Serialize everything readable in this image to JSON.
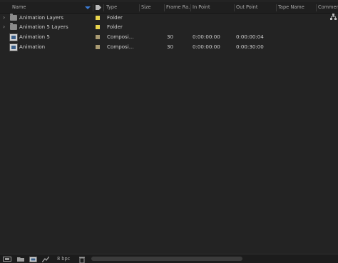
{
  "columns": {
    "name": "Name",
    "type": "Type",
    "size": "Size",
    "frame_rate": "Frame Ra...",
    "in_point": "In Point",
    "out_point": "Out Point",
    "tape_name": "Tape Name",
    "comment": "Commen"
  },
  "rows": [
    {
      "name": "Animation Layers",
      "type": "Folder",
      "frame_rate": "",
      "in_point": "",
      "out_point": "",
      "label_color": "#e8d44d"
    },
    {
      "name": "Animation 5 Layers",
      "type": "Folder",
      "frame_rate": "",
      "in_point": "",
      "out_point": "",
      "label_color": "#e8d44d"
    },
    {
      "name": "Animation 5",
      "type": "Composi...",
      "frame_rate": "30",
      "in_point": "0:00:00:00",
      "out_point": "0:00:00:04",
      "label_color": "#a99a72"
    },
    {
      "name": "Animation",
      "type": "Composi...",
      "frame_rate": "30",
      "in_point": "0:00:00:00",
      "out_point": "0:00:30:00",
      "label_color": "#a99a72"
    }
  ],
  "footer": {
    "bit_depth": "8 bpc"
  },
  "colors": {
    "panel_bg": "#232323",
    "accent": "#3a7bd5"
  },
  "icons": [
    "chevron-right-icon",
    "folder-icon",
    "composition-icon",
    "label-icon",
    "flowchart-icon",
    "interpret-footage-icon",
    "new-folder-icon",
    "new-composition-icon",
    "delete-icon"
  ]
}
